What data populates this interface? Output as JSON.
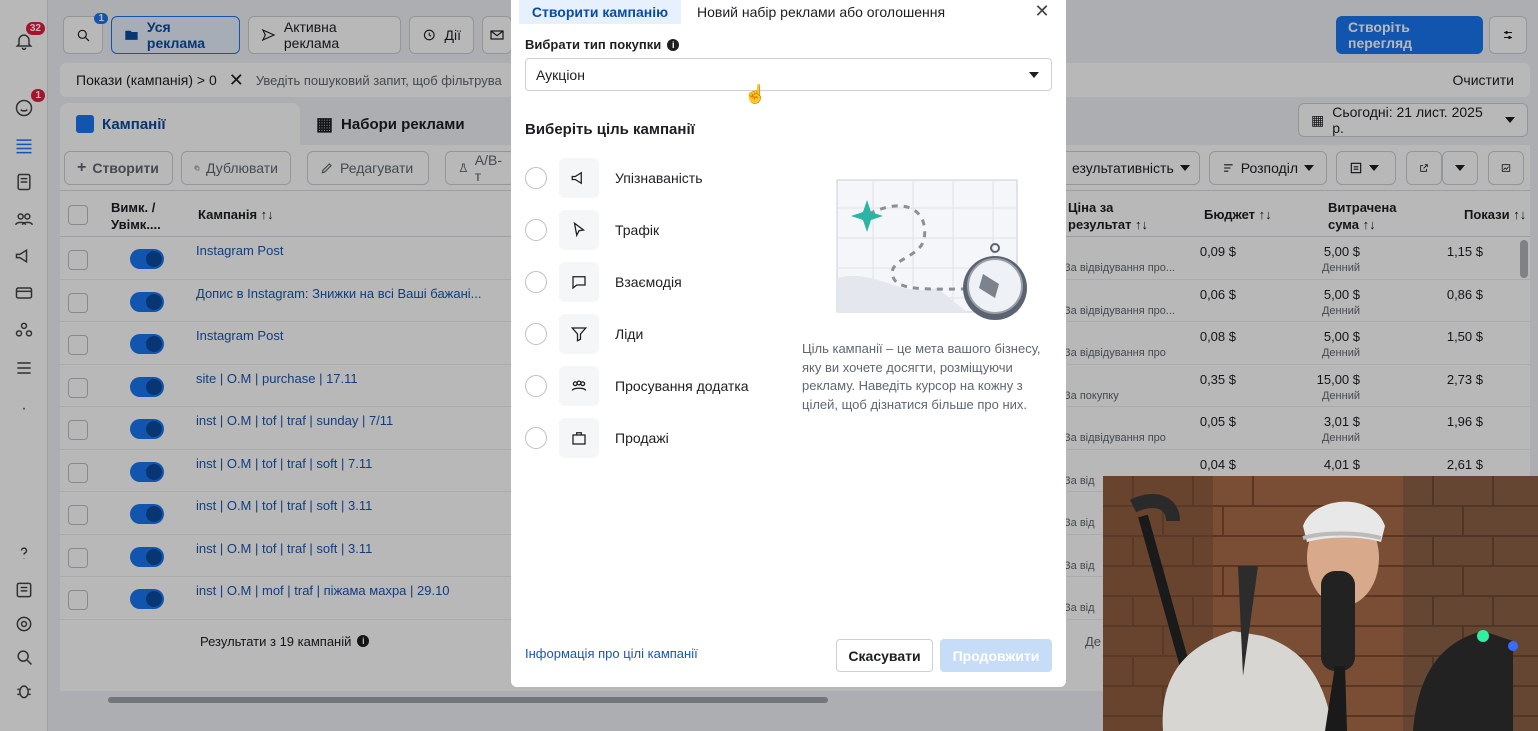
{
  "rail": {
    "notif_count": "32",
    "alert_count": "1"
  },
  "topbar": {
    "search_badge": "1",
    "all_ads": "Уся реклама",
    "active_ads": "Активна реклама",
    "actions": "Дії",
    "create_view": "Створіть перегляд"
  },
  "filter": {
    "chip": "Покази (кампанія) > 0",
    "placeholder": "Уведіть пошуковий запит, щоб фільтрува",
    "clear": "Очистити"
  },
  "tabs": {
    "campaigns": "Кампанії",
    "adsets": "Набори реклами"
  },
  "date_label": "Сьогодні: 21 лист. 2025 р.",
  "toolbar": {
    "create": "Створити",
    "duplicate": "Дублювати",
    "edit": "Редагувати",
    "ab": "A/B-т",
    "performance": "езультативність",
    "breakdown": "Розподіл"
  },
  "columns": {
    "toggle": "Вимк. / Увімк....",
    "campaign": "Кампанія ↑↓",
    "cost": "Ціна за результат ↑↓",
    "budget": "Бюджет ↑↓",
    "spent": "Витрачена сума ↑↓",
    "impressions": "Покази ↑↓"
  },
  "rows": [
    {
      "name": "Instagram Post",
      "cost": "0,09 $",
      "cost_sub": "За відвідування про...",
      "budget": "5,00 $",
      "budget_sub": "Денний",
      "spent": "1,15 $"
    },
    {
      "name": "Допис в Instagram: Знижки на всі Ваші бажані...",
      "cost": "0,06 $",
      "cost_sub": "За відвідування про...",
      "budget": "5,00 $",
      "budget_sub": "Денний",
      "spent": "0,86 $"
    },
    {
      "name": "Instagram Post",
      "cost": "0,08 $",
      "cost_sub": "За відвідування про",
      "budget": "5,00 $",
      "budget_sub": "Денний",
      "spent": "1,50 $"
    },
    {
      "name": "site | O.M | purchase | 17.11",
      "cost": "0,35 $",
      "cost_sub": "За покупку",
      "budget": "15,00 $",
      "budget_sub": "Денний",
      "spent": "2,73 $"
    },
    {
      "name": "inst | O.M | tof | traf | sunday | 7/11",
      "cost": "0,05 $",
      "cost_sub": "За відвідування про",
      "budget": "3,01 $",
      "budget_sub": "Денний",
      "spent": "1,96 $"
    },
    {
      "name": "inst | O.M | tof | traf | soft | 7.11",
      "cost": "0,04 $",
      "cost_sub": "За від",
      "budget": "4,01 $",
      "budget_sub": "",
      "spent": "2,61 $"
    },
    {
      "name": "inst | O.M | tof | traf | soft | 3.11",
      "cost": "",
      "cost_sub": "За від",
      "budget": "",
      "budget_sub": "",
      "spent": ""
    },
    {
      "name": "inst | O.M | tof | traf | soft | 3.11",
      "cost": "",
      "cost_sub": "За від",
      "budget": "",
      "budget_sub": "",
      "spent": ""
    },
    {
      "name": "inst | O.M | mof | traf | піжама махра | 29.10",
      "cost": "",
      "cost_sub": "За від",
      "budget": "",
      "budget_sub": "",
      "spent": ""
    }
  ],
  "footer": {
    "results": "Результати з 19 кампаній",
    "daily": "Де"
  },
  "modal": {
    "tab_create": "Створити кампанію",
    "tab_new": "Новий набір реклами або оголошення",
    "buy_type_label": "Вибрати тип покупки",
    "buy_type_value": "Аукціон",
    "goal_heading": "Виберіть ціль кампанії",
    "options": [
      "Упізнаваність",
      "Трафік",
      "Взаємодія",
      "Ліди",
      "Просування додатка",
      "Продажі"
    ],
    "description": "Ціль кампанії – це мета вашого бізнесу, яку ви хочете досягти, розміщуючи рекламу. Наведіть курсор на кожну з цілей, щоб дізнатися більше про них.",
    "info_link": "Інформація про цілі кампанії",
    "cancel": "Скасувати",
    "continue": "Продовжити"
  },
  "colors": {
    "accent": "#1877f2",
    "create_green": "#1b7e4b",
    "link": "#1a56b0"
  }
}
